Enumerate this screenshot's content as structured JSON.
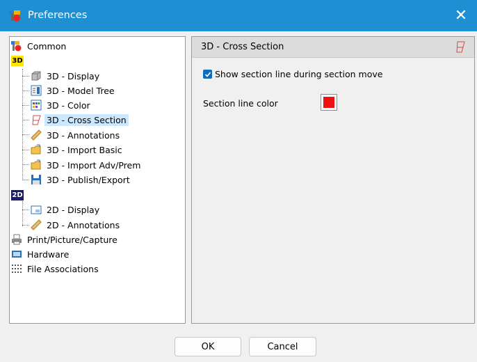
{
  "window": {
    "title": "Preferences"
  },
  "tree": {
    "items": [
      {
        "label": "Common"
      },
      {
        "badge": "3D"
      },
      {
        "label": "3D - Display"
      },
      {
        "label": "3D - Model Tree"
      },
      {
        "label": "3D - Color"
      },
      {
        "label": "3D - Cross Section",
        "selected": true
      },
      {
        "label": "3D - Annotations"
      },
      {
        "label": "3D - Import Basic"
      },
      {
        "label": "3D - Import Adv/Prem"
      },
      {
        "label": "3D - Publish/Export"
      },
      {
        "badge": "2D"
      },
      {
        "label": "2D - Display"
      },
      {
        "label": "2D - Annotations"
      },
      {
        "label": "Print/Picture/Capture"
      },
      {
        "label": "Hardware"
      },
      {
        "label": "File Associations"
      }
    ]
  },
  "panel": {
    "title": "3D - Cross Section",
    "show_section_line_label": "Show section line during section move",
    "show_section_line_checked": true,
    "section_line_color_label": "Section line color",
    "section_line_color": "#ee1111"
  },
  "buttons": {
    "ok": "OK",
    "cancel": "Cancel"
  },
  "colors": {
    "titlebar": "#1f8fd4",
    "selection": "#cce8ff",
    "checkbox": "#0f6cbd"
  }
}
